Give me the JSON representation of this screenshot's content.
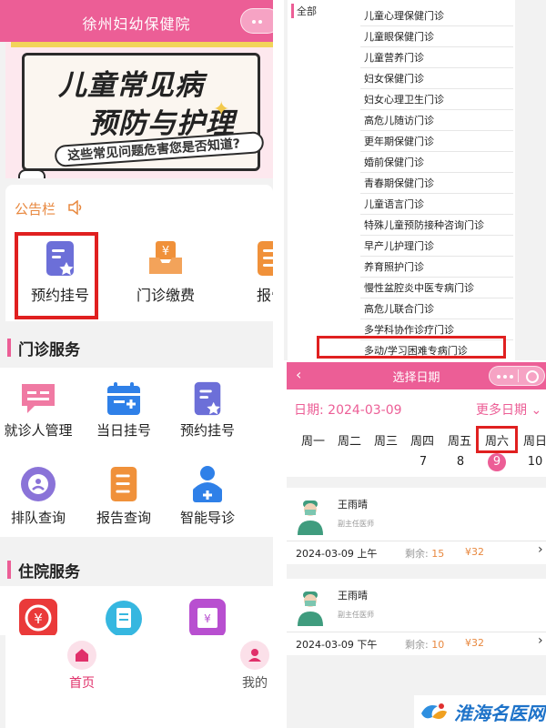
{
  "left": {
    "header": {
      "title": "徐州妇幼保健院"
    },
    "banner": {
      "line1": "儿童常见病",
      "line2": "预防与护理",
      "subtitle": "这些常见问题危害您是否知道?"
    },
    "notice": {
      "label": "公告栏"
    },
    "quick_actions": [
      {
        "label": "预约挂号",
        "icon": "appointment-star-icon"
      },
      {
        "label": "门诊缴费",
        "icon": "payment-yen-tray-icon"
      },
      {
        "label": "报告",
        "icon": "report-list-icon"
      }
    ],
    "outpatient": {
      "title": "门诊服务",
      "items": [
        {
          "label": "就诊人管理",
          "icon": "patient-chat-icon"
        },
        {
          "label": "当日挂号",
          "icon": "calendar-add-icon"
        },
        {
          "label": "预约挂号",
          "icon": "appointment-star-icon"
        },
        {
          "label": "门",
          "icon": "partial-icon"
        },
        {
          "label": "排队查询",
          "icon": "queue-search-icon"
        },
        {
          "label": "报告查询",
          "icon": "report-list-icon"
        },
        {
          "label": "智能导诊",
          "icon": "guide-person-icon"
        }
      ]
    },
    "inpatient": {
      "title": "住院服务",
      "items": [
        {
          "icon": "yen-circle-icon"
        },
        {
          "icon": "document-icon"
        },
        {
          "icon": "receipt-icon"
        }
      ]
    },
    "tabbar": {
      "home": "首页",
      "mine": "我的"
    },
    "colors": {
      "brand": "#ec5e96",
      "accent": "#e8883f",
      "highlight": "#e02020"
    }
  },
  "departments": {
    "filter_label": "全部",
    "list": [
      "儿童心理保健门诊",
      "儿童眼保健门诊",
      "儿童营养门诊",
      "妇女保健门诊",
      "妇女心理卫生门诊",
      "高危儿随访门诊",
      "更年期保健门诊",
      "婚前保健门诊",
      "青春期保健门诊",
      "儿童语言门诊",
      "特殊儿童预防接种咨询门诊",
      "早产儿护理门诊",
      "养育照护门诊",
      "慢性盆腔炎中医专病门诊",
      "高危儿联合门诊",
      "多学科协作诊疗门诊",
      "多动/学习困难专病门诊"
    ],
    "selected": "多动/学习困难专病门诊"
  },
  "date_select": {
    "header_title": "选择日期",
    "back_icon": "back-arrow-icon",
    "date_label": "日期:  2024-03-09",
    "more_dates": "更多日期",
    "weekdays": [
      "周一",
      "周二",
      "周三",
      "周四",
      "周五",
      "周六",
      "周日"
    ],
    "days": [
      "",
      "",
      "",
      "7",
      "8",
      "9",
      "10"
    ],
    "selected_weekday": "周六",
    "doctors": [
      {
        "name": "王雨晴",
        "title": "副主任医师",
        "slot": "2024-03-09 上午",
        "remaining_label": "剩余:",
        "remaining": "15",
        "price": "¥32"
      },
      {
        "name": "王雨晴",
        "title": "副主任医师",
        "slot": "2024-03-09 下午",
        "remaining_label": "剩余:",
        "remaining": "10",
        "price": "¥32"
      }
    ]
  },
  "watermark": {
    "text": "淮海名医网"
  }
}
